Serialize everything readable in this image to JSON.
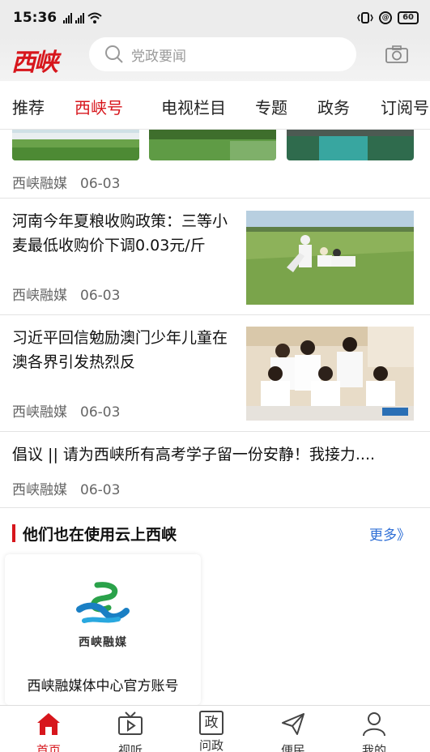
{
  "status_bar": {
    "time": "15:36",
    "battery": "60",
    "network_a": "3G",
    "network_b": "4G"
  },
  "header": {
    "logo_text": "西峡",
    "search_placeholder": "党政要闻",
    "camera_icon": "camera-icon"
  },
  "tabs": [
    {
      "label": "推荐",
      "active": false
    },
    {
      "label": "西峡号",
      "active": true
    },
    {
      "label": "电视栏目",
      "active": false
    },
    {
      "label": "专题",
      "active": false
    },
    {
      "label": "政务",
      "active": false
    },
    {
      "label": "订阅号",
      "active": false
    }
  ],
  "feed": {
    "first_item_meta": {
      "source": "西峡融媒",
      "date": "06-03"
    },
    "items": [
      {
        "title": "河南今年夏粮收购政策：三等小麦最低收购价下调0.03元/斤",
        "source": "西峡融媒",
        "date": "06-03"
      },
      {
        "title": "习近平回信勉励澳门少年儿童在澳各界引发热烈反",
        "source": "西峡融媒",
        "date": "06-03"
      },
      {
        "title": "倡议 || 请为西峡所有高考学子留一份安静！我接力....",
        "source": "西峡融媒",
        "date": "06-03"
      }
    ]
  },
  "section": {
    "title": "他们也在使用云上西峡",
    "more": "更多》"
  },
  "account_card": {
    "logo_text": "西峡融媒",
    "name": "西峡融媒体中心官方账号"
  },
  "bottom_nav": [
    {
      "label": "首页",
      "icon": "home-icon",
      "active": true
    },
    {
      "label": "视听",
      "icon": "tv-icon",
      "active": false
    },
    {
      "label": "问政",
      "icon": "zheng-icon",
      "active": false
    },
    {
      "label": "便民",
      "icon": "send-icon",
      "active": false
    },
    {
      "label": "我的",
      "icon": "user-icon",
      "active": false
    }
  ],
  "colors": {
    "accent": "#d7161c",
    "link": "#2f6fd6"
  }
}
